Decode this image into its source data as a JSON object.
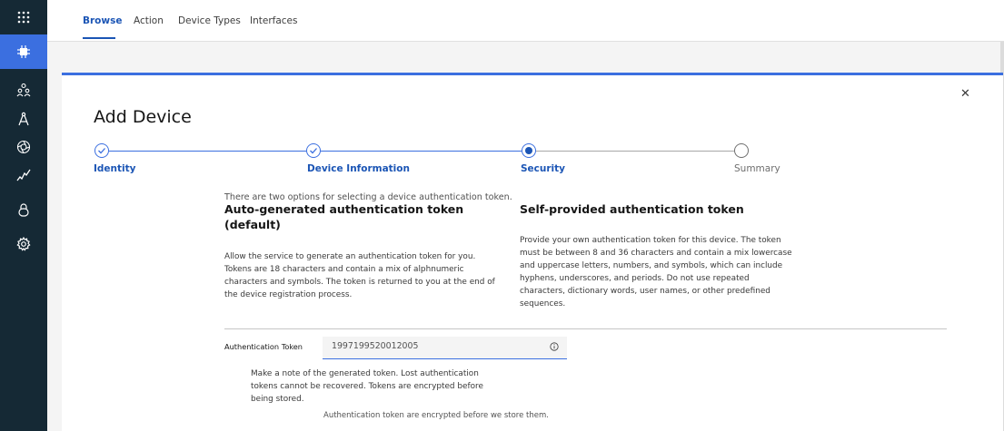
{
  "rail": {
    "items": [
      {
        "icon": "apps-grid-icon",
        "active": false
      },
      {
        "icon": "chip-icon",
        "active": true
      },
      {
        "icon": "members-icon",
        "active": false
      },
      {
        "icon": "compass-icon",
        "active": false
      },
      {
        "icon": "aperture-icon",
        "active": false
      },
      {
        "icon": "analytics-icon",
        "active": false
      },
      {
        "icon": "lock-icon",
        "active": false
      },
      {
        "icon": "settings-icon",
        "active": false
      }
    ]
  },
  "topnav": {
    "tabs": [
      {
        "label": "Browse",
        "active": true
      },
      {
        "label": "Action",
        "active": false
      },
      {
        "label": "Device Types",
        "active": false
      },
      {
        "label": "Interfaces",
        "active": false
      }
    ]
  },
  "modal": {
    "title": "Add Device",
    "close_icon": "close-icon",
    "steps": [
      {
        "label": "Identity",
        "state": "complete"
      },
      {
        "label": "Device Information",
        "state": "complete"
      },
      {
        "label": "Security",
        "state": "current"
      },
      {
        "label": "Summary",
        "state": "incomplete"
      }
    ],
    "intro": "There are two options for selecting a device authentication token.",
    "auto_option": {
      "title": "Auto-generated authentication token (default)",
      "description": "Allow the service to generate an authentication token for you. Tokens are 18 characters and contain a mix of alphnumeric characters and symbols. The token is returned to you at the end of the device registration process."
    },
    "self_option": {
      "title": "Self-provided authentication token",
      "description": "Provide your own authentication token for this device. The token must be between 8 and 36 characters and contain a mix lowercase and uppercase letters, numbers, and symbols, which can include hyphens, underscores, and periods. Do not use repeated characters, dictionary words, user names, or other predefined sequences."
    },
    "token_field": {
      "label": "Authentication Token",
      "value": "1997199520012005"
    },
    "note": "Make a note of the generated token. Lost authentication tokens cannot be recovered. Tokens are encrypted before being stored.",
    "helper": "Authentication token are encrypted before we store them."
  },
  "colors": {
    "rail_bg": "#152935",
    "accent": "#3b6fe0",
    "link": "#1b55b5"
  }
}
